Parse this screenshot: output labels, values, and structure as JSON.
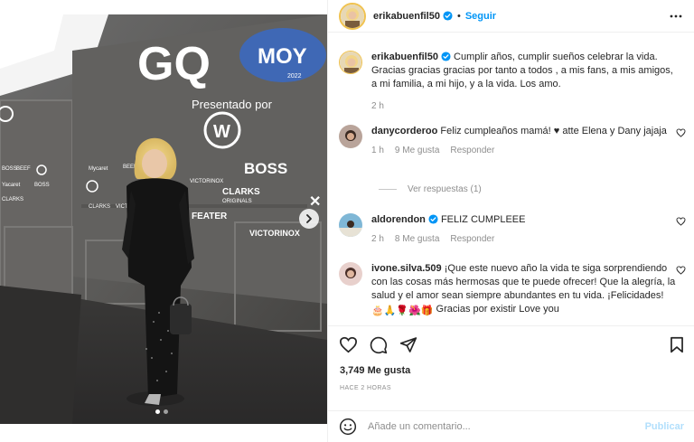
{
  "post": {
    "username": "erikabuenfil50",
    "follow_label": "Seguir",
    "separator": "•",
    "caption_text": "Cumplir años, cumplir sueños celebrar la vida. Gracias gracias gracias por tanto a todos , a mis fans, a mis amigos, a mi familia, a mi hijo, y a la vida. Los amo.",
    "caption_time": "2 h"
  },
  "media": {
    "brand_gq": "GQ",
    "presented_by": "Presentado por",
    "boss": "BOSS",
    "clarks": "CLARKS",
    "clarks_sub": "ORIGINALS",
    "victorinox": "VICTORINOX",
    "year": "2022",
    "feater": "FEATER"
  },
  "comments": [
    {
      "username": "danycorderoo",
      "text": "Feliz cumpleaños mamá! ♥ atte Elena y Dany jajaja",
      "time": "1 h",
      "likes": "9 Me gusta",
      "reply": "Responder",
      "view_replies": "Ver respuestas (1)"
    },
    {
      "username": "aldorendon",
      "text": "FELIZ CUMPLEEE",
      "time": "2 h",
      "likes": "8 Me gusta",
      "reply": "Responder"
    },
    {
      "username": "ivone.silva.509",
      "text": "¡Que este nuevo año la vida te siga sorprendiendo con las cosas más hermosas que te puede ofrecer! Que la alegría, la salud y el amor sean siempre abundantes en tu vida. ¡Felicidades!",
      "emojis": "🎂🙏🌹🌺🎁",
      "text_end": "Gracias por existir",
      "text_tail": "Love you"
    }
  ],
  "footer": {
    "likes": "3,749 Me gusta",
    "timestamp": "HACE 2 HORAS",
    "comment_placeholder": "Añade un comentario...",
    "publish_label": "Publicar"
  },
  "colors": {
    "accent": "#0095f6",
    "publish_disabled": "#b2dffc",
    "muted": "#8e8e8e",
    "verified": "#0095f6"
  },
  "carousel": {
    "active_index": 1,
    "count": 2
  }
}
